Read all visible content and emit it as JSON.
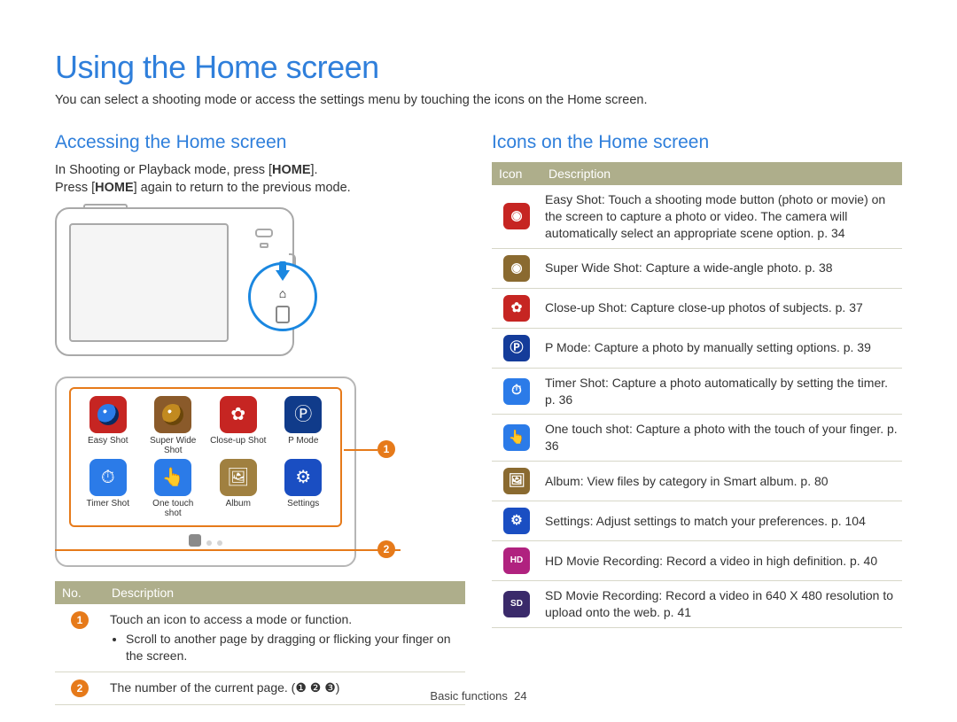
{
  "title": "Using the Home screen",
  "intro": "You can select a shooting mode or access the settings menu by touching the icons on the Home screen.",
  "left": {
    "heading": "Accessing the Home screen",
    "line1a": "In Shooting or Playback mode, press [",
    "line1b": "HOME",
    "line1c": "].",
    "line2a": "Press [",
    "line2b": "HOME",
    "line2c": "] again to return to the previous mode.",
    "grid": [
      {
        "label": "Easy Shot",
        "iconClass": "ic-red ic-lens",
        "glyph": ""
      },
      {
        "label": "Super Wide Shot",
        "iconClass": "ic-brown ic-lens gold",
        "glyph": ""
      },
      {
        "label": "Close-up Shot",
        "iconClass": "ic-red",
        "glyph": "✿"
      },
      {
        "label": "P Mode",
        "iconClass": "ic-dblue",
        "glyph": "Ⓟ"
      },
      {
        "label": "Timer Shot",
        "iconClass": "ic-lblue",
        "glyph": "⏱"
      },
      {
        "label": "One touch shot",
        "iconClass": "ic-lblue",
        "glyph": "👆"
      },
      {
        "label": "Album",
        "iconClass": "ic-olive",
        "glyph": "🖼"
      },
      {
        "label": "Settings",
        "iconClass": "ic-blue",
        "glyph": "⚙"
      }
    ],
    "tableHead": {
      "c1": "No.",
      "c2": "Description"
    },
    "row1": {
      "num": "1",
      "desc": "Touch an icon to access a mode or function.",
      "bullet": "Scroll to another page by dragging or flicking your finger on the screen."
    },
    "row2": {
      "num": "2",
      "desc": "The number of the current page. (❶ ❷ ❸)"
    }
  },
  "right": {
    "heading": "Icons on the Home screen",
    "tableHead": {
      "c1": "Icon",
      "c2": "Description"
    },
    "rows": [
      {
        "iconClass": "red",
        "glyph": "◉",
        "bold": "Easy Shot",
        "rest": ": Touch a shooting mode button (photo or movie) on the screen to capture a photo or video. The camera will automatically select an appropriate scene option. p. 34"
      },
      {
        "iconClass": "olive",
        "glyph": "◉",
        "bold": "Super Wide Shot",
        "rest": ": Capture a wide-angle photo. p. 38"
      },
      {
        "iconClass": "red",
        "glyph": "✿",
        "bold": "Close-up Shot",
        "rest": ": Capture close-up photos of subjects. p. 37"
      },
      {
        "iconClass": "dblue",
        "glyph": "Ⓟ",
        "bold": "P Mode",
        "rest": ": Capture a photo by manually setting options. p. 39"
      },
      {
        "iconClass": "lblue",
        "glyph": "⏱",
        "bold": "Timer Shot",
        "rest": ": Capture a photo automatically by setting the timer. p. 36"
      },
      {
        "iconClass": "lblue",
        "glyph": "👆",
        "bold": "One touch shot",
        "rest": ": Capture a photo with the touch of your finger. p. 36"
      },
      {
        "iconClass": "olive",
        "glyph": "🖼",
        "bold": "Album",
        "rest": ": View files by category in Smart album. p. 80"
      },
      {
        "iconClass": "blue",
        "glyph": "⚙",
        "bold": "Settings",
        "rest": ": Adjust settings to match your preferences. p. 104"
      },
      {
        "iconClass": "pink",
        "glyph": "HD",
        "bold": "HD Movie Recording",
        "rest": ": Record a video in high definition. p. 40"
      },
      {
        "iconClass": "purple",
        "glyph": "SD",
        "bold": "SD Movie Recording",
        "rest": ": Record a video in 640 X 480 resolution to upload onto the web. p. 41"
      }
    ]
  },
  "footer": {
    "section": "Basic functions",
    "page": "24"
  }
}
